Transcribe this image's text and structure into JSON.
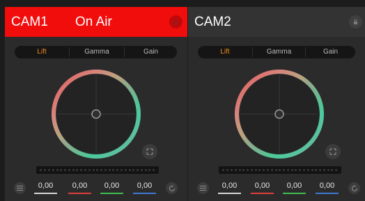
{
  "colors": {
    "on_air_red": "#f20d0d",
    "tab_active": "#f28b1a",
    "line_y": "#d8d8d8",
    "line_r": "#e0403a",
    "line_g": "#3fbf4f",
    "line_b": "#3f78d6"
  },
  "cameras": [
    {
      "name": "CAM1",
      "status": "On Air",
      "tabs": [
        "Lift",
        "Gamma",
        "Gain"
      ],
      "active_tab": "Lift",
      "values": [
        "0,00",
        "0,00",
        "0,00",
        "0,00"
      ]
    },
    {
      "name": "CAM2",
      "status": "",
      "tabs": [
        "Lift",
        "Gamma",
        "Gain"
      ],
      "active_tab": "Lift",
      "values": [
        "0,00",
        "0,00",
        "0,00",
        "0,00"
      ]
    }
  ],
  "icons": [
    "lock-icon",
    "expand-icon",
    "menu-icon",
    "reset-icon"
  ]
}
